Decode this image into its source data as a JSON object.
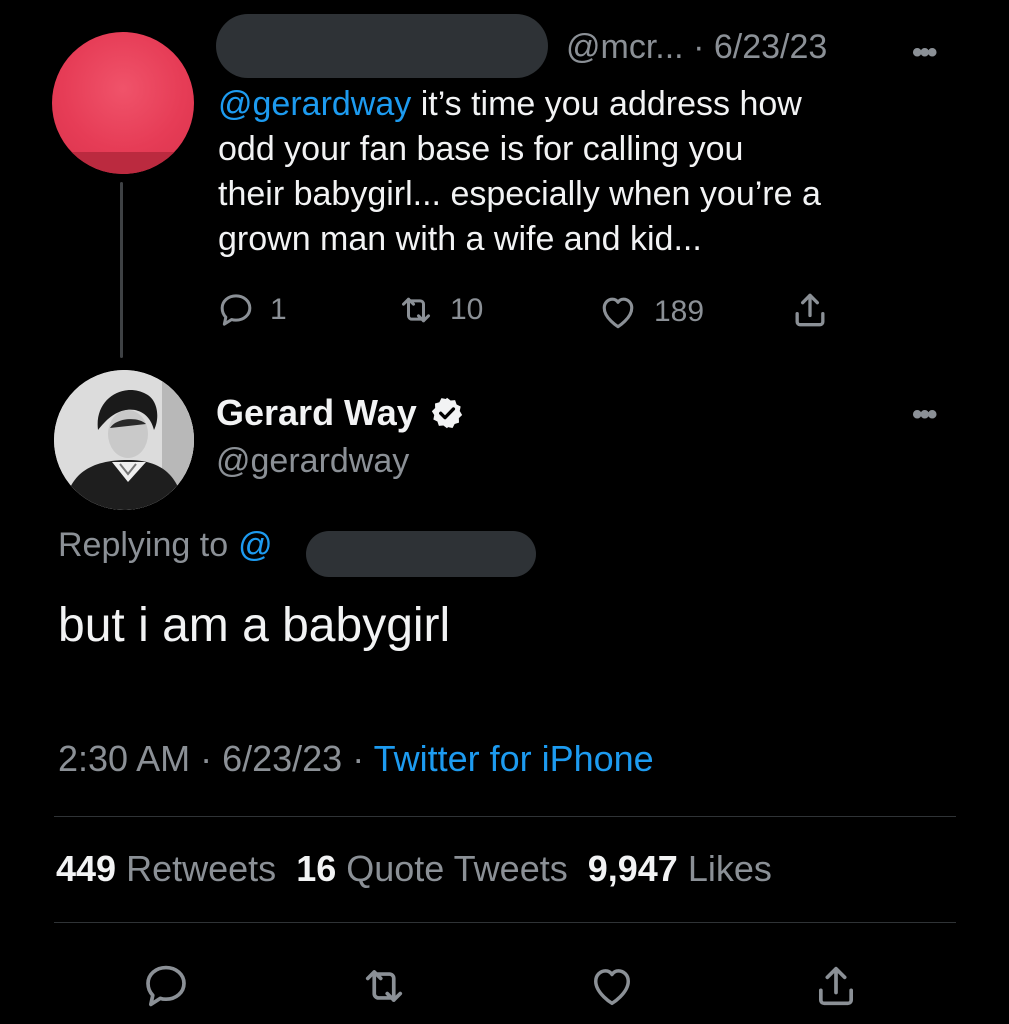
{
  "parent_tweet": {
    "handle": "@mcr...",
    "separator": "·",
    "date": "6/23/23",
    "mention": "@gerardway",
    "text_line1": " it’s time you address how",
    "text_line2": "odd your fan base is for calling you",
    "text_line3": "their babygirl... especially when you’re a",
    "text_line4": "grown man with a wife and kid...",
    "replies": "1",
    "retweets": "10",
    "likes": "189",
    "more": "•••",
    "avatar_color": "#e63c56"
  },
  "reply_tweet": {
    "display_name": "Gerard Way",
    "handle": "@gerardway",
    "more": "•••",
    "replying_label": "Replying to ",
    "replying_at": "@",
    "text": "but i am a babygirl",
    "time": "2:30 AM",
    "sep1": " · ",
    "date": "6/23/23",
    "sep2": " · ",
    "source": "Twitter for iPhone"
  },
  "stats": {
    "retweets_count": "449",
    "retweets_label": "Retweets",
    "quotes_count": "16",
    "quotes_label": "Quote Tweets",
    "likes_count": "9,947",
    "likes_label": "Likes"
  },
  "colors": {
    "link": "#1d9bf0",
    "secondary": "#8b9096",
    "background": "#000000"
  }
}
